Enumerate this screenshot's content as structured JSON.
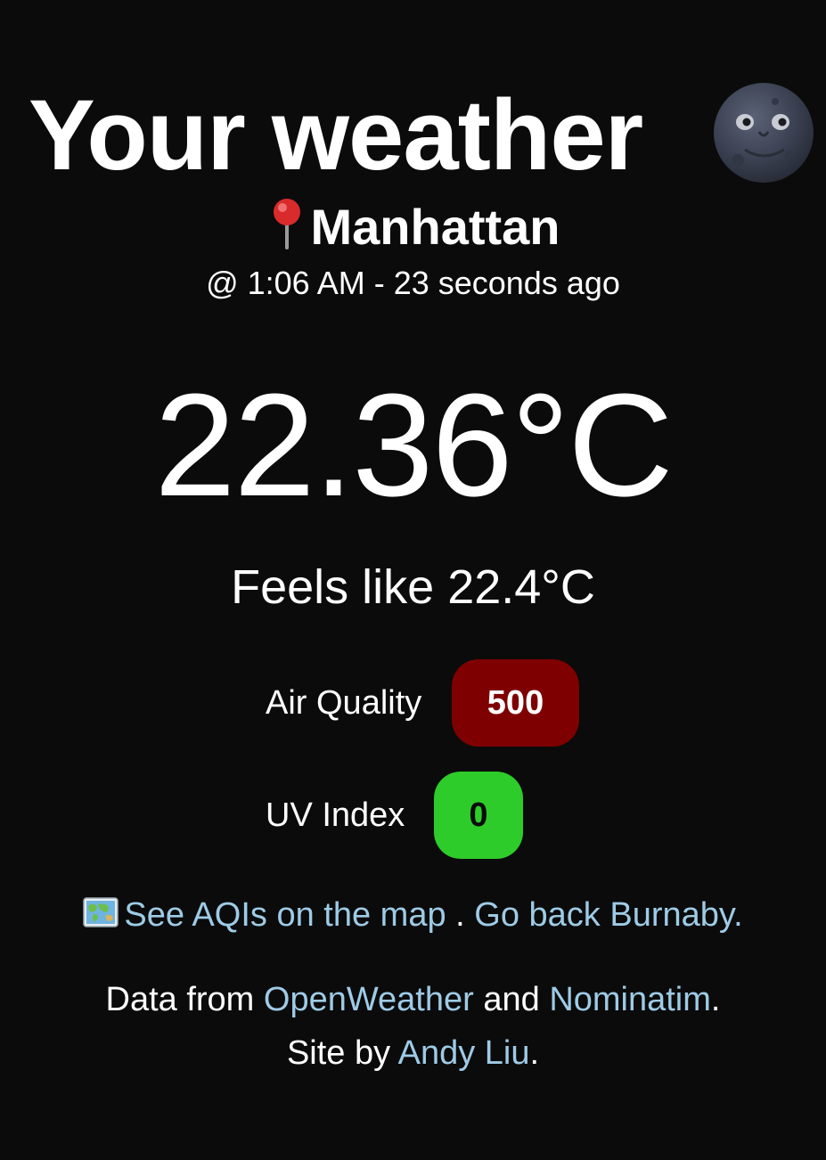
{
  "header": {
    "title": "Your weather",
    "weather_icon": "new-moon-face-icon",
    "location_icon": "round-pushpin-icon",
    "location": "Manhattan",
    "timestamp": "@ 1:06 AM - 23 seconds ago"
  },
  "current": {
    "temperature": "22.36°C",
    "feels_like": "Feels like 22.4°C"
  },
  "metrics": {
    "air_quality": {
      "label": "Air Quality",
      "value": "500",
      "color": "#7f0000"
    },
    "uv_index": {
      "label": "UV Index",
      "value": "0",
      "color": "#2ecc2a"
    }
  },
  "links": {
    "map_icon": "world-map-icon",
    "map_link": "See AQIs on the map",
    "separator": ".",
    "back_link": "Go back Burnaby."
  },
  "footer": {
    "data_prefix": "Data from",
    "source_1": "OpenWeather",
    "and_text": "and",
    "source_2": "Nominatim",
    "period_1": ".",
    "site_prefix": "Site by",
    "author": "Andy Liu",
    "period_2": "."
  },
  "colors": {
    "background": "#0b0b0b",
    "text": "#ffffff",
    "link": "#9ecbe6"
  }
}
